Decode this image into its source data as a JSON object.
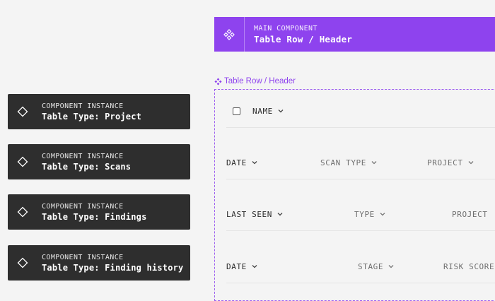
{
  "main_component": {
    "kicker": "MAIN COMPONENT",
    "title": "Table Row / Header",
    "icon": "component-icon",
    "color": "#8e43ee"
  },
  "component_label": "Table Row / Header",
  "instances": [
    {
      "kicker": "COMPONENT INSTANCE",
      "title": "Table Type: Project",
      "icon": "instance-icon"
    },
    {
      "kicker": "COMPONENT INSTANCE",
      "title": "Table Type: Scans",
      "icon": "instance-icon"
    },
    {
      "kicker": "COMPONENT INSTANCE",
      "title": "Table Type: Findings",
      "icon": "instance-icon"
    },
    {
      "kicker": "COMPONENT INSTANCE",
      "title": "Table Type: Finding history",
      "icon": "instance-icon"
    }
  ],
  "variants": {
    "project": {
      "name": "NAME"
    },
    "scans": {
      "date": "DATE",
      "scan_type": "SCAN TYPE",
      "project": "PROJECT"
    },
    "findings": {
      "last_seen": "LAST SEEN",
      "type": "TYPE",
      "project": "PROJECT"
    },
    "finding_history": {
      "date": "DATE",
      "stage": "STAGE",
      "risk_score": "RISK SCORE"
    }
  }
}
